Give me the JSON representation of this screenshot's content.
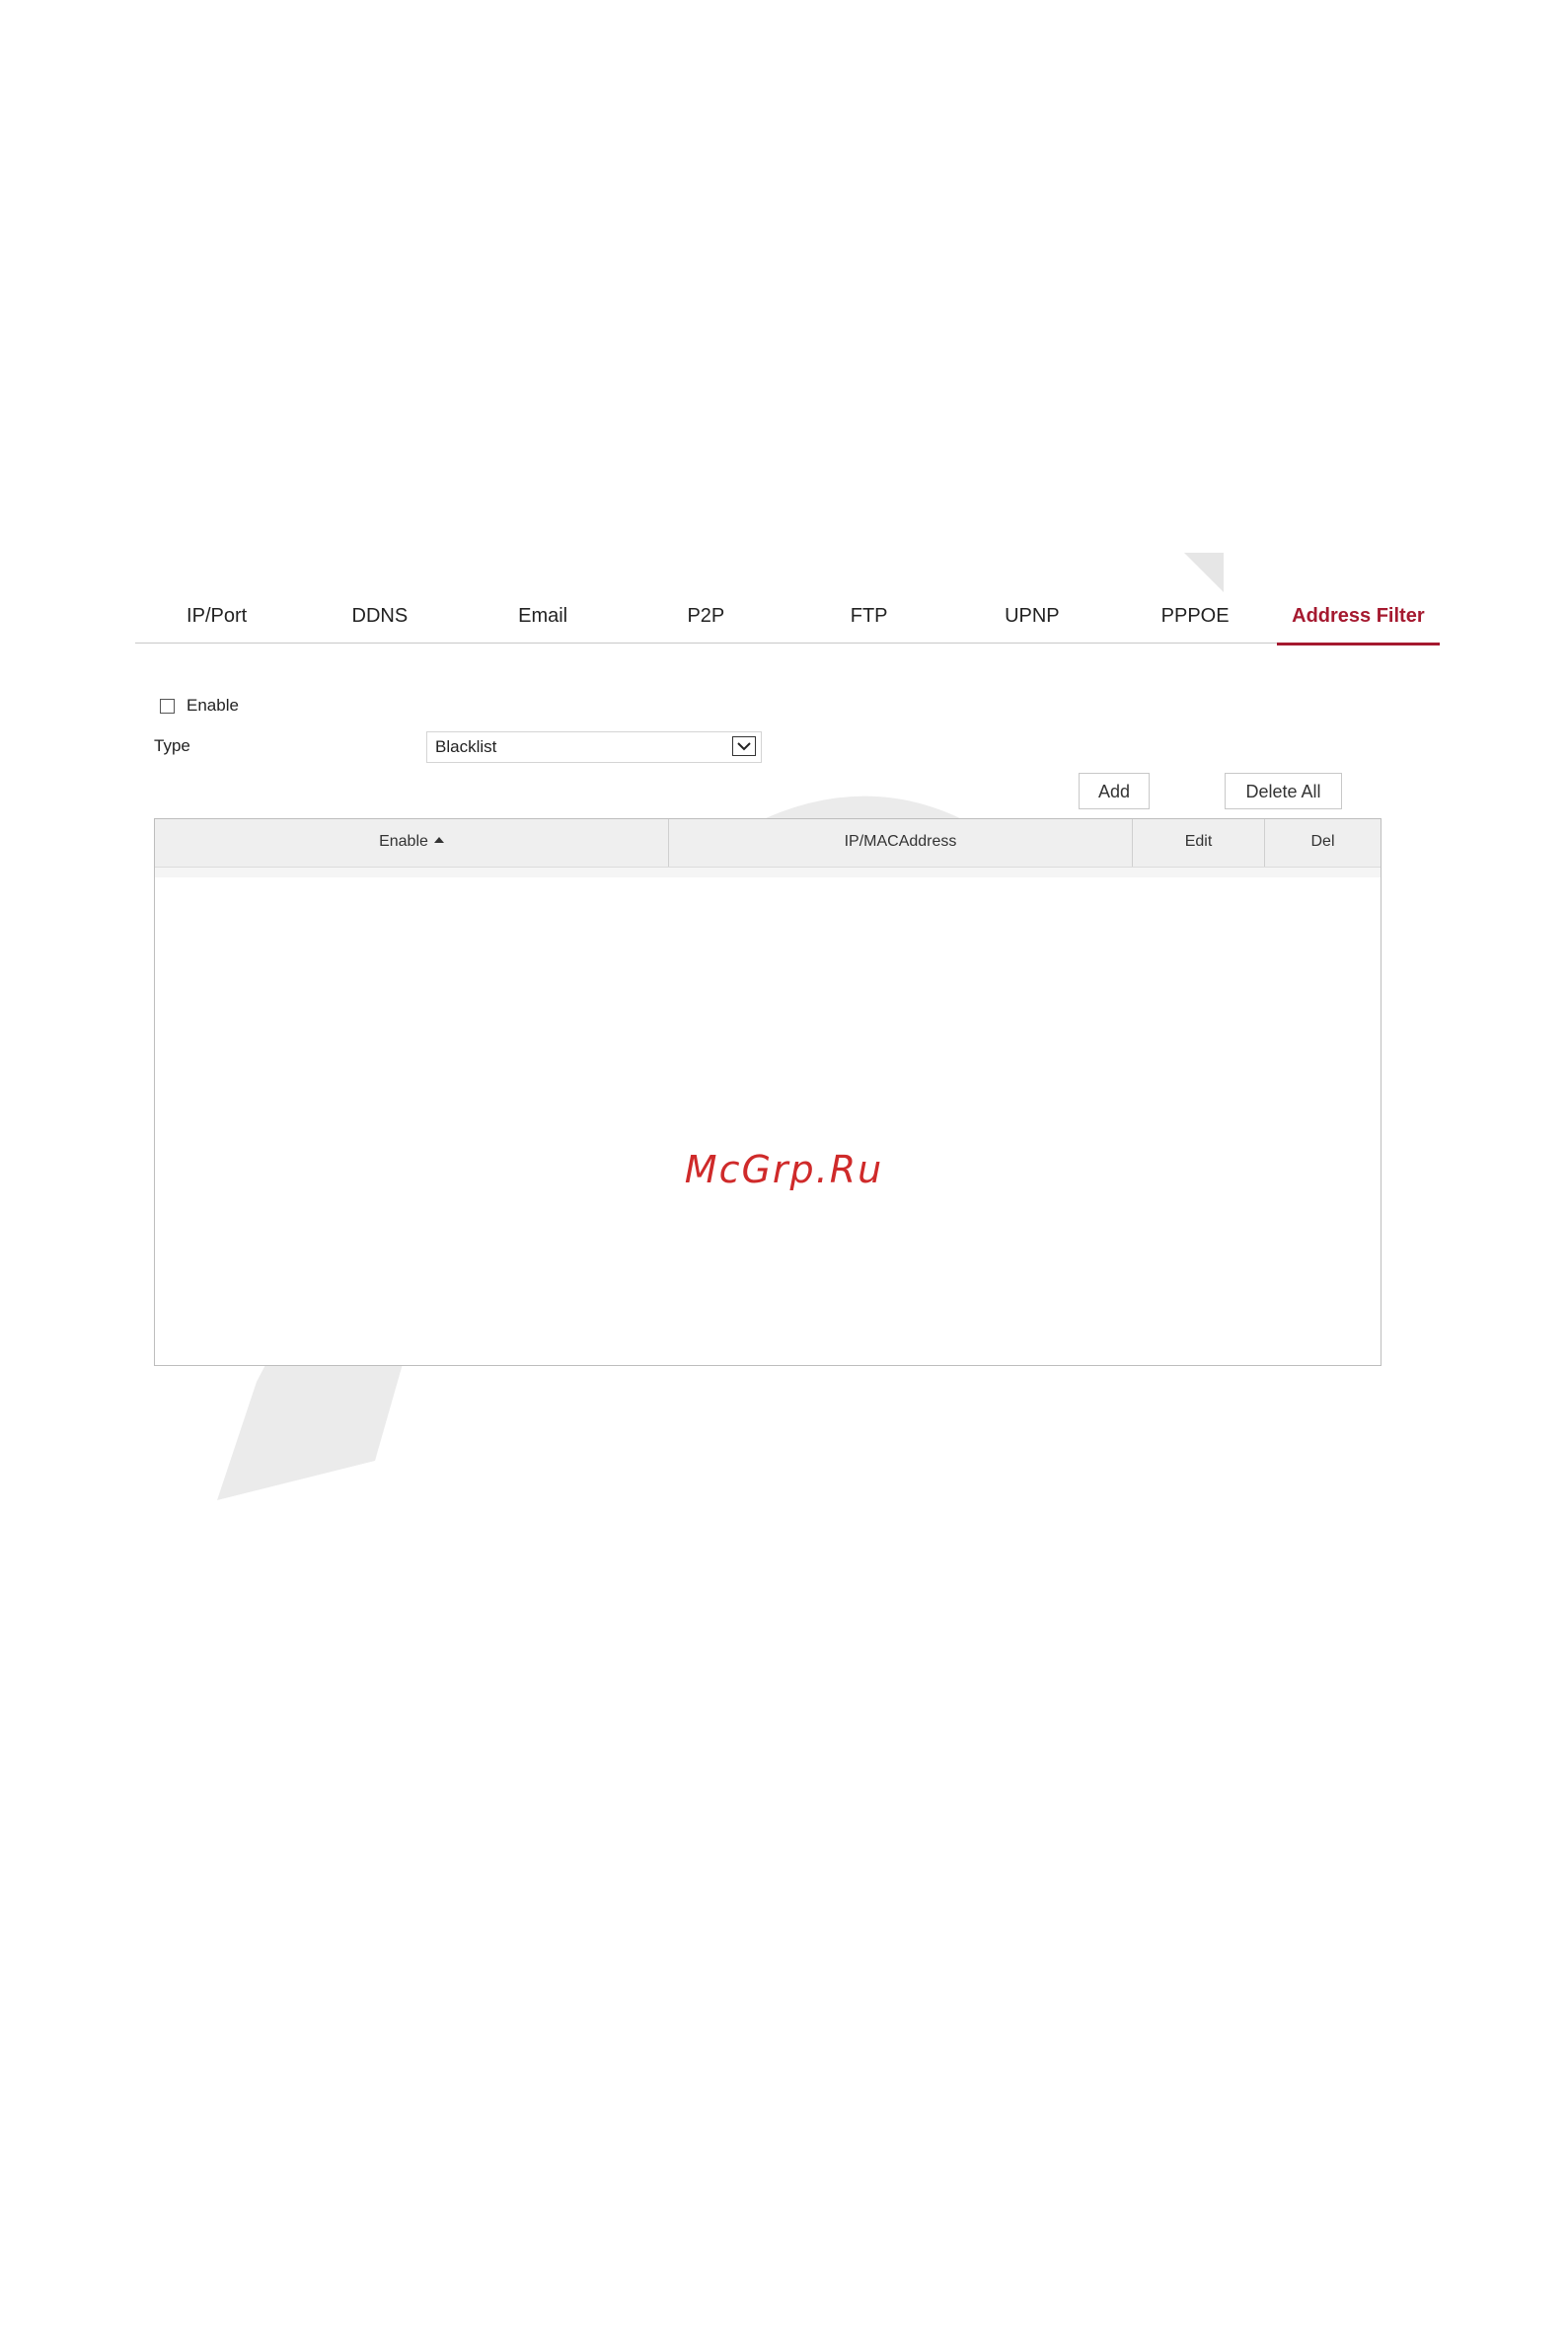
{
  "tabs": [
    {
      "label": "IP/Port"
    },
    {
      "label": "DDNS"
    },
    {
      "label": "Email"
    },
    {
      "label": "P2P"
    },
    {
      "label": "FTP"
    },
    {
      "label": "UPNP"
    },
    {
      "label": "PPPOE"
    },
    {
      "label": "Address Filter",
      "active": true
    }
  ],
  "form": {
    "enable_label": "Enable",
    "enable_checked": false,
    "type_label": "Type",
    "type_value": "Blacklist"
  },
  "buttons": {
    "add": "Add",
    "delete_all": "Delete All"
  },
  "table": {
    "columns": [
      "Enable",
      "IP/MACAddress",
      "Edit",
      "Del"
    ],
    "rows": []
  },
  "watermark_text": "McGrp.Ru",
  "colors": {
    "accent": "#a5192f",
    "watermark": "#cf2a2a"
  }
}
